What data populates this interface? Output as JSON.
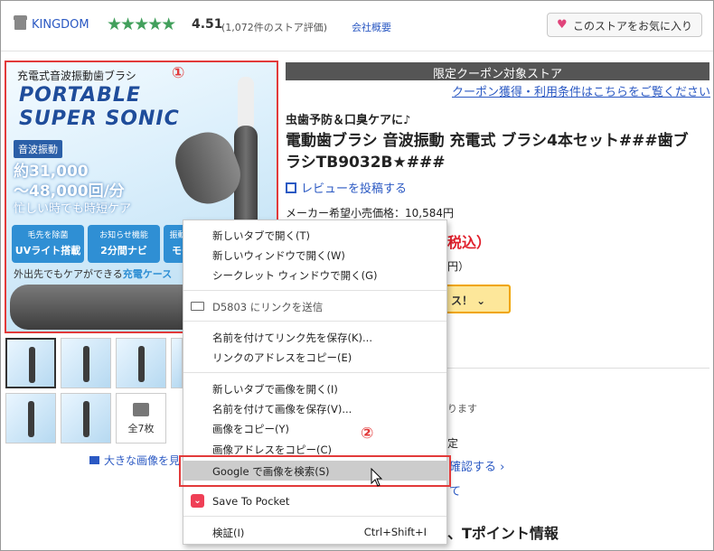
{
  "header": {
    "store_name": "KINGDOM",
    "stars": "★★★★★",
    "rating": "4.51",
    "rating_count": "(1,072件のストア評価)",
    "company_link": "会社概要",
    "fav_button": "このストアをお気に入り"
  },
  "main_image": {
    "caption": "充電式音波振動歯ブラシ",
    "logo_line1": "PORTABLE",
    "logo_line2": "SUPER SONIC",
    "badge": "音波振動",
    "num1": "約31,000",
    "num2": "〜48,000回/分",
    "busy": "忙しい時でも時短ケア",
    "tiles": [
      {
        "top": "毛先を除菌",
        "bottom": "UVライト搭載"
      },
      {
        "top": "お知らせ機能",
        "bottom": "2分間ナビ"
      },
      {
        "top": "振動パ",
        "bottom": "モー"
      }
    ],
    "outing_prefix": "外出先でもケアができる",
    "outing_highlight": "充電ケース",
    "marker1": "①"
  },
  "thumbnails": {
    "all_label": "全7枚",
    "large_link": "大きな画像を見"
  },
  "product": {
    "coupon_header": "限定クーポン対象ストア",
    "coupon_link": "クーポン獲得・利用条件はこちらをご覧ください",
    "catch": "虫歯予防＆口臭ケアに♪",
    "title": "電動歯ブラシ 音波振動 充電式 ブラシ4本セット###歯ブラシTB9032B★###",
    "review": "レビューを投稿する",
    "maker_price": "メーカー希望小売価格：10,584円",
    "price_fragment": "税込）",
    "fragment2": "円）",
    "button_fragment": "ス！ ⌄",
    "fragment3": "ります",
    "fragment4": "定",
    "fragment5": "確認する ›",
    "fragment6": "て",
    "fragment7": "、Tポイント情報"
  },
  "context_menu": {
    "items": [
      {
        "label": "新しいタブで開く(T)"
      },
      {
        "label": "新しいウィンドウで開く(W)"
      },
      {
        "label": "シークレット ウィンドウで開く(G)"
      },
      {
        "label": "D5803 にリンクを送信"
      },
      {
        "label": "名前を付けてリンク先を保存(K)..."
      },
      {
        "label": "リンクのアドレスをコピー(E)"
      },
      {
        "label": "新しいタブで画像を開く(I)"
      },
      {
        "label": "名前を付けて画像を保存(V)..."
      },
      {
        "label": "画像をコピー(Y)"
      },
      {
        "label": "画像アドレスをコピー(C)"
      },
      {
        "label": "Google で画像を検索(S)"
      },
      {
        "label": "Save To Pocket"
      },
      {
        "label": "検証(I)",
        "shortcut": "Ctrl+Shift+I"
      }
    ],
    "marker2": "②"
  },
  "colors": {
    "accent_link": "#2b59c3",
    "highlight_box": "#e23a3a",
    "star": "#42a05c",
    "price": "#e0202c"
  }
}
